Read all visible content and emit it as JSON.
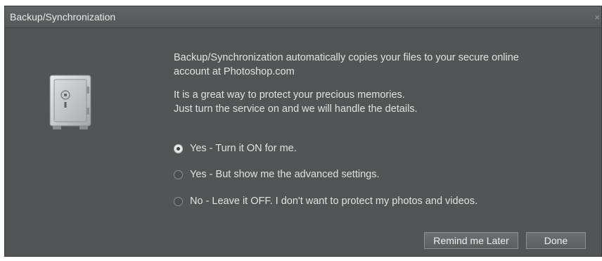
{
  "window": {
    "title": "Backup/Synchronization",
    "close_glyph": "×"
  },
  "icon": {
    "name": "safe-icon"
  },
  "body": {
    "paragraph1_line1": "Backup/Synchronization automatically copies your files to your secure online",
    "paragraph1_line2": "account at Photoshop.com",
    "paragraph2_line1": "It is a great way to protect your precious memories.",
    "paragraph2_line2": "Just turn the service on and we will handle the details."
  },
  "options": [
    {
      "label": "Yes - Turn it ON for me.",
      "selected": true
    },
    {
      "label": "Yes - But show me the advanced settings.",
      "selected": false
    },
    {
      "label": "No - Leave it OFF. I don't want to protect my photos and videos.",
      "selected": false
    }
  ],
  "buttons": {
    "remind_label": "Remind me Later",
    "done_label": "Done"
  },
  "colors": {
    "dialog_bg": "#525556",
    "text": "#e1e1e1"
  }
}
